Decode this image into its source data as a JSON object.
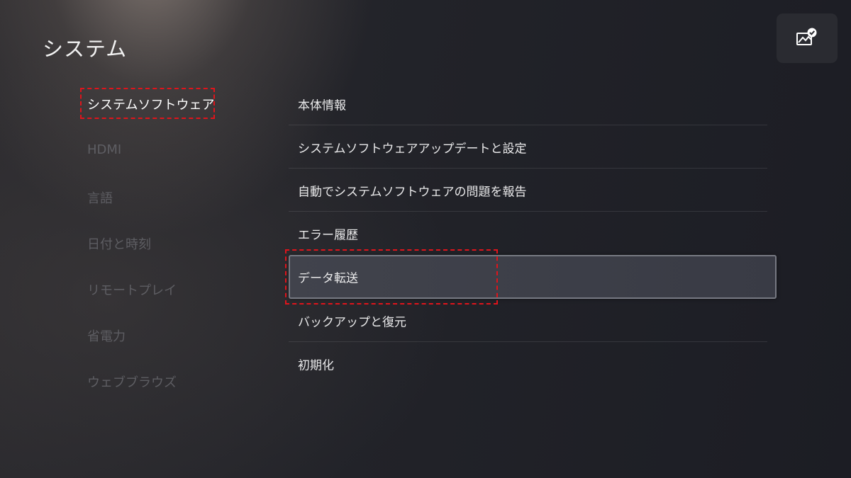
{
  "header": {
    "title": "システム"
  },
  "profile": {
    "icon": "gallery-check-icon"
  },
  "sidebar": {
    "items": [
      {
        "label": "システムソフトウェア",
        "active": true
      },
      {
        "label": "HDMI"
      },
      {
        "label": "言語"
      },
      {
        "label": "日付と時刻"
      },
      {
        "label": "リモートプレイ"
      },
      {
        "label": "省電力"
      },
      {
        "label": "ウェブブラウズ"
      }
    ]
  },
  "menu": {
    "items": [
      {
        "label": "本体情報"
      },
      {
        "label": "システムソフトウェアアップデートと設定"
      },
      {
        "label": "自動でシステムソフトウェアの問題を報告"
      },
      {
        "label": "エラー履歴"
      },
      {
        "label": "データ転送",
        "focused": true
      },
      {
        "label": "バックアップと復元"
      },
      {
        "label": "初期化"
      }
    ]
  },
  "annotation_color": "#e0141b"
}
